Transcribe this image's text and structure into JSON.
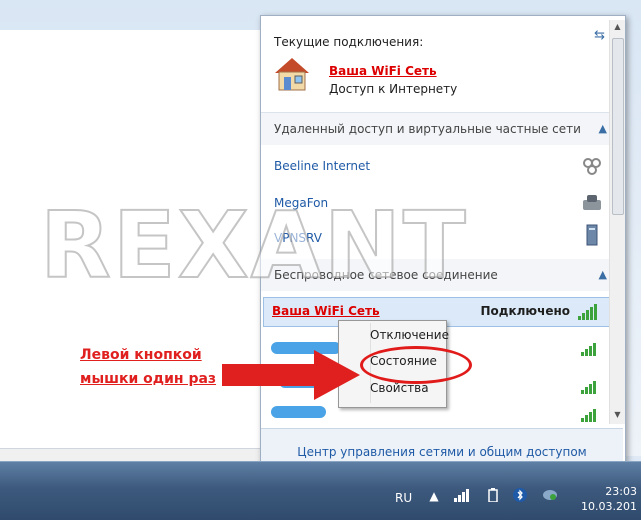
{
  "watermark": "REXANT",
  "flyout": {
    "current_connections_label": "Текущие подключения:",
    "active_network": {
      "name": "Ваша WiFi Сеть",
      "status": "Доступ к Интернету"
    },
    "vpn_group": {
      "label": "Удаленный доступ и виртуальные частные сети",
      "items": [
        {
          "label": "Beeline Internet",
          "icon": "dialup-icon"
        },
        {
          "label": "MegaFon",
          "icon": "modem-icon"
        },
        {
          "label": "VPNSRV",
          "icon": "server-icon"
        }
      ]
    },
    "wireless_group": {
      "label": "Беспроводное сетевое соединение"
    },
    "selected_network": {
      "name": "Ваша WiFi Сеть",
      "status": "Подключено"
    },
    "footer_link": "Центр управления сетями и общим доступом"
  },
  "context_menu": {
    "items": [
      "Отключение",
      "Состояние",
      "Свойства"
    ]
  },
  "annotation": {
    "line1": "Левой кнопкой",
    "line2": "мышки один раз"
  },
  "taskbar": {
    "language": "RU",
    "time": "23:03",
    "date": "10.03.201"
  },
  "colors": {
    "accent_red": "#e01f1f",
    "link_blue": "#1f5aa6",
    "signal_green": "#3ca23c"
  }
}
